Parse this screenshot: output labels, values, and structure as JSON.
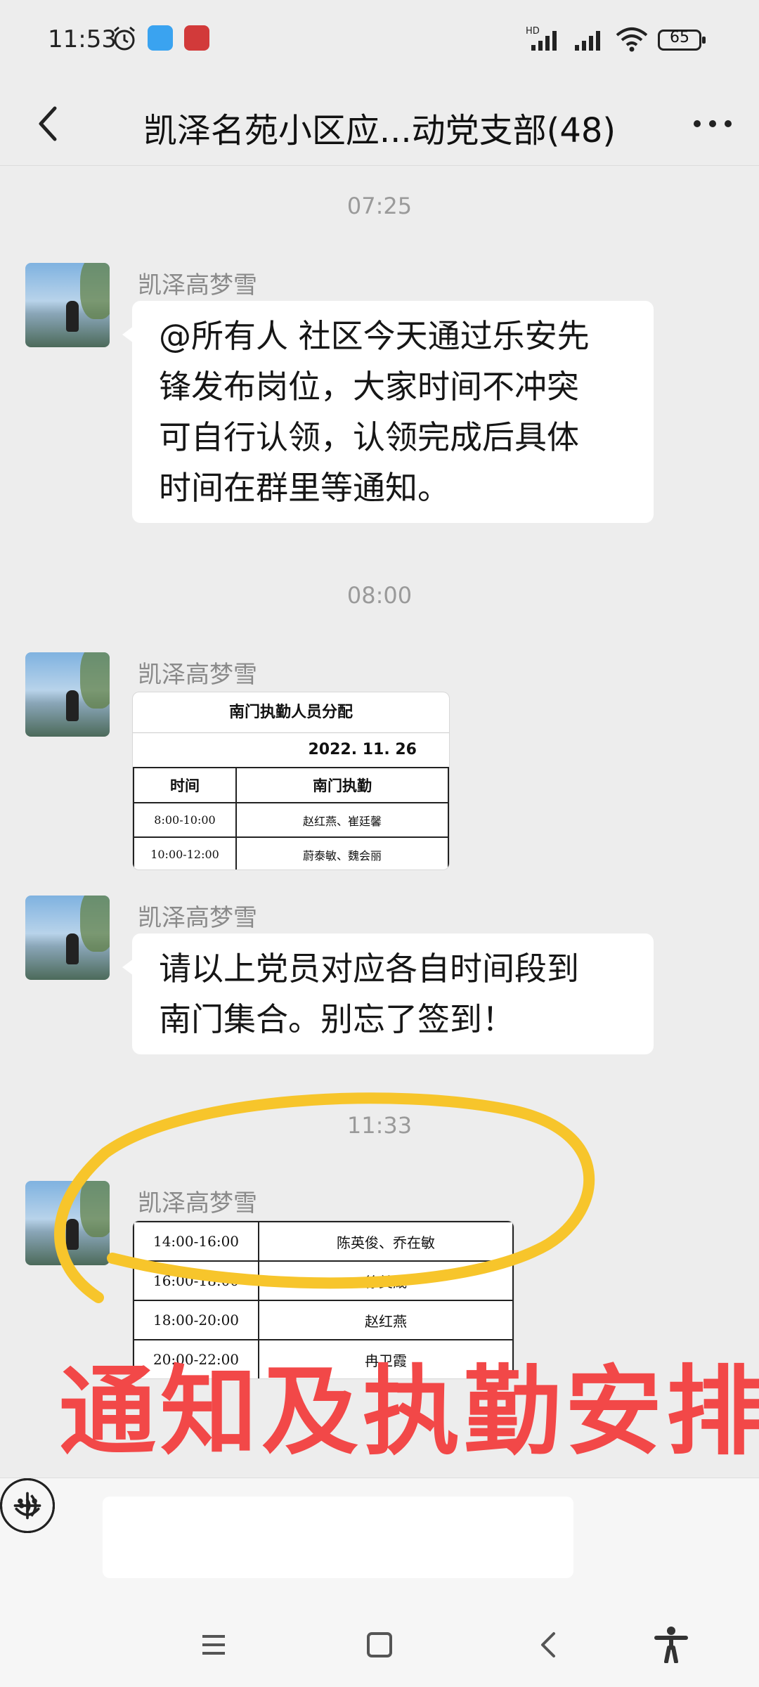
{
  "status_bar": {
    "time": "11:53",
    "battery": "65",
    "signal_label": "HD"
  },
  "header": {
    "title": "凯泽名苑小区应...动党支部(48)"
  },
  "messages": [
    {
      "timestamp": "07:25",
      "sender": "凯泽高梦雪",
      "text_lines": [
        "@所有人 社区今天通过乐安先",
        "锋发布岗位，大家时间不冲突",
        "可自行认领，认领完成后具体",
        "时间在群里等通知。"
      ]
    },
    {
      "timestamp": "08:00",
      "sender": "凯泽高梦雪",
      "image_table": {
        "caption": "南门执勤人员分配",
        "date": "2022. 11. 26",
        "headers": [
          "时间",
          "南门执勤"
        ],
        "rows": [
          [
            "8:00-10:00",
            "赵红燕、崔廷馨"
          ],
          [
            "10:00-12:00",
            "蔚泰敏、魏会丽"
          ]
        ]
      }
    },
    {
      "sender": "凯泽高梦雪",
      "text_lines": [
        "请以上党员对应各自时间段到",
        "南门集合。别忘了签到！"
      ]
    },
    {
      "timestamp": "11:33",
      "sender": "凯泽高梦雪",
      "image_table": {
        "rows": [
          [
            "14:00-16:00",
            "陈英俊、乔在敏"
          ],
          [
            "16:00-18:00",
            "徐美箴"
          ],
          [
            "18:00-20:00",
            "赵红燕"
          ],
          [
            "20:00-22:00",
            "冉卫霞"
          ]
        ]
      }
    }
  ],
  "overlay": {
    "caption": "通知及执勤安排",
    "color_red": "#f24848",
    "color_yellow": "#f7c52b"
  },
  "icons": {
    "back": "chevron-left-icon",
    "more": "ellipsis-icon",
    "voice": "voice-icon",
    "emoji": "emoji-icon",
    "plus": "plus-icon",
    "nav_menu": "menu-icon",
    "nav_home": "home-icon",
    "nav_back": "back-icon",
    "accessibility": "accessibility-icon"
  }
}
